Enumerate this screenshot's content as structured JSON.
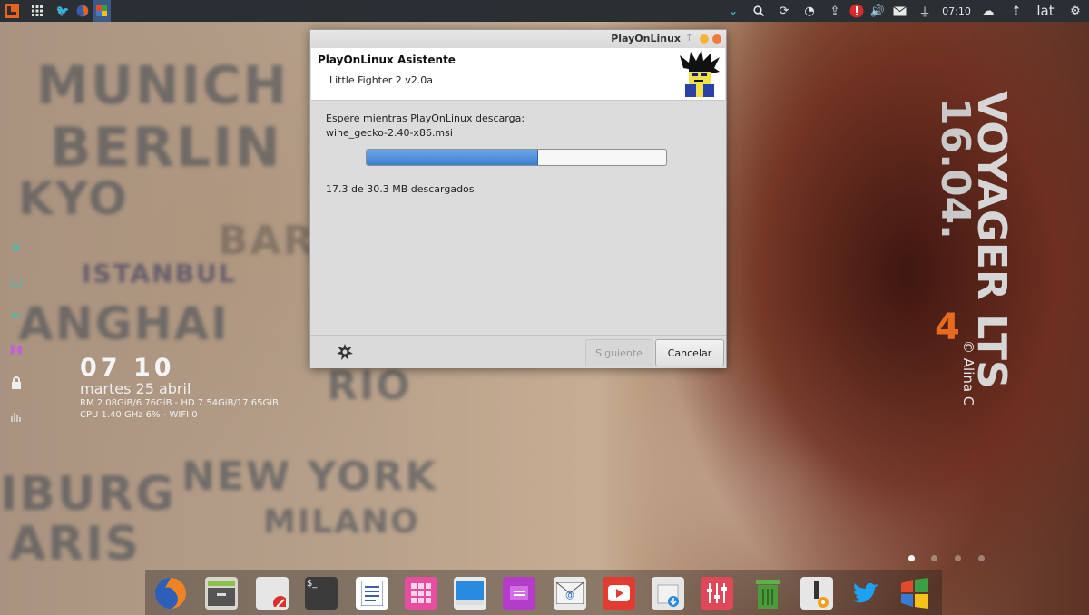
{
  "top_panel": {
    "time": "07:10",
    "keyboard_layout": "lat",
    "left_icons": [
      "ubuntu-menu-icon",
      "apps-grid-icon",
      "twitter-icon",
      "firefox-icon",
      "playonlinux-icon"
    ],
    "right_icons": [
      "chevron-down-icon",
      "search-icon",
      "refresh-icon",
      "clock-icon",
      "upload-icon",
      "alert-icon",
      "volume-icon",
      "mail-icon",
      "power-plug-icon",
      "cloud-icon",
      "gear-icon"
    ]
  },
  "desktop": {
    "wallpaper_cities": [
      "MUNICH",
      "BERLIN",
      "KYO",
      "BARCE",
      "ISTANBUL",
      "ANGHAI",
      "RIO",
      "NEW YORK",
      "MILANO",
      "IBURG",
      "ARIS"
    ],
    "voyager_title": "VOYAGER LTS",
    "voyager_version": "16.04.",
    "voyager_number": "4",
    "copyright": "© Alina C"
  },
  "conky": {
    "time": "07 10",
    "date": "martes 25 abril",
    "line1": "RM 2.08GiB/6.76GiB - HD 7.54GiB/17.65GiB",
    "line2": "CPU 1.40 GHz 6% - WIFI 0"
  },
  "window": {
    "titlebar": "PlayOnLinux",
    "header_title": "PlayOnLinux Asistente",
    "header_subtitle": "Little Fighter 2 v2.0a",
    "wait_label": "Espere mientras PlayOnLinux descarga:",
    "filename": "wine_gecko-2.40-x86.msi",
    "progress_fraction": 0.571,
    "downloaded_text": "17.3 de 30.3 MB descargados",
    "next_button": "Siguiente",
    "cancel_button": "Cancelar",
    "colors": {
      "progress": "#3d7fd2",
      "close": "#f07a3c",
      "minimize": "#f5b33a"
    }
  },
  "dock": {
    "items": [
      "firefox-icon",
      "file-manager-icon",
      "text-editor-icon",
      "terminal-icon",
      "writer-icon",
      "apps-icon",
      "desktop-icon",
      "purple-box-icon",
      "mail-client-icon",
      "youtube-icon",
      "software-center-icon",
      "mixer-icon",
      "trash-icon",
      "settings-icon",
      "twitter-icon",
      "windows-icon"
    ]
  }
}
